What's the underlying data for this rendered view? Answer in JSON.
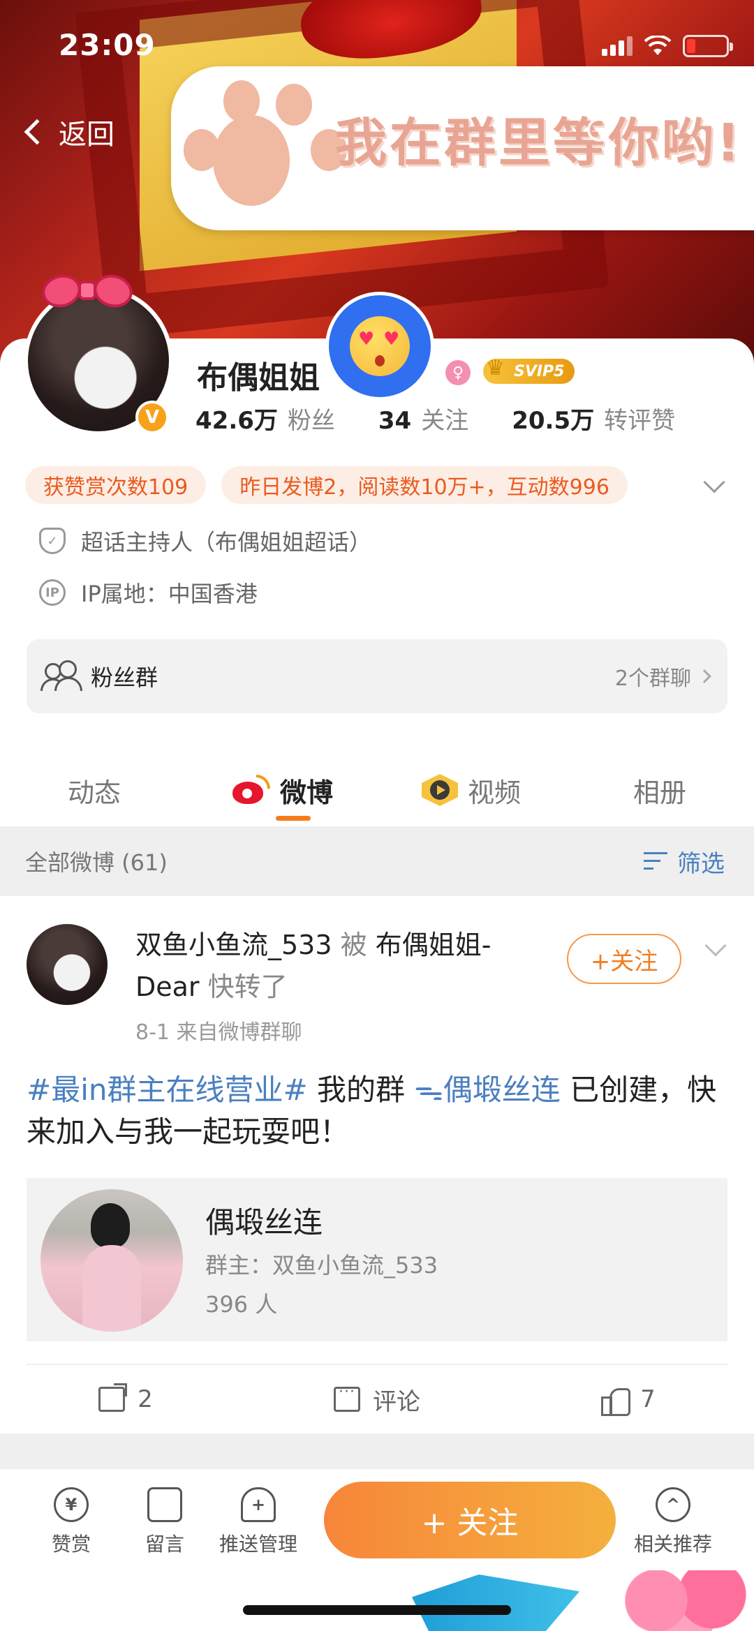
{
  "status_bar": {
    "time": "23:09"
  },
  "nav": {
    "back_label": "返回"
  },
  "banner": {
    "slogan": "我在群里等你哟!"
  },
  "profile": {
    "nickname": "布偶姐姐",
    "vip_label": "SVIP5",
    "verified_mark": "V",
    "stats": [
      {
        "num": "42.6万",
        "label": "粉丝"
      },
      {
        "num": "34",
        "label": "关注"
      },
      {
        "num": "20.5万",
        "label": "转评赞"
      }
    ],
    "tags": [
      "获赞赏次数109",
      "昨日发博2，阅读数10万+，互动数996"
    ],
    "host_info": "超话主持人（布偶姐姐超话）",
    "ip_info": "IP属地：中国香港",
    "ip_icon": "IP"
  },
  "fan_group": {
    "title": "粉丝群",
    "count": "2个群聊"
  },
  "tabs": [
    {
      "label": "动态"
    },
    {
      "label": "微博"
    },
    {
      "label": "视频"
    },
    {
      "label": "相册"
    }
  ],
  "filter_bar": {
    "all_label": "全部微博 (61)",
    "filter_label": "筛选"
  },
  "post": {
    "author": "双鱼小鱼流_533",
    "by_label": "被",
    "reposter": "布偶姐姐-Dear",
    "action": "快转了",
    "meta": "8-1  来自微博群聊",
    "follow_label": "+关注",
    "hashtag": "#最in群主在线营业#",
    "text_before_group": " 我的群 ",
    "group_link": "偶塅丝连",
    "text_after_group": " 已创建，快来加入与我一起玩耍吧！",
    "group_card": {
      "name": "偶塅丝连",
      "owner": "群主：双鱼小鱼流_533",
      "count": "396 人"
    },
    "actions": {
      "share_count": "2",
      "comment_label": "评论",
      "like_count": "7"
    }
  },
  "toolbar": {
    "items": [
      {
        "label": "赞赏",
        "icon": "yen-icon",
        "glyph": "¥"
      },
      {
        "label": "留言",
        "icon": "message-icon",
        "glyph": ""
      },
      {
        "label": "推送管理",
        "icon": "bell-plus-icon",
        "glyph": "+"
      },
      {
        "label": "相关推荐",
        "icon": "chevron-up-circle-icon",
        "glyph": "^"
      }
    ],
    "follow_label": "+ 关注"
  },
  "colors": {
    "accent_orange": "#f27d20",
    "link_blue": "#4a7fc0",
    "tag_bg": "#fdeee5",
    "tag_text": "#ea5a1f"
  }
}
